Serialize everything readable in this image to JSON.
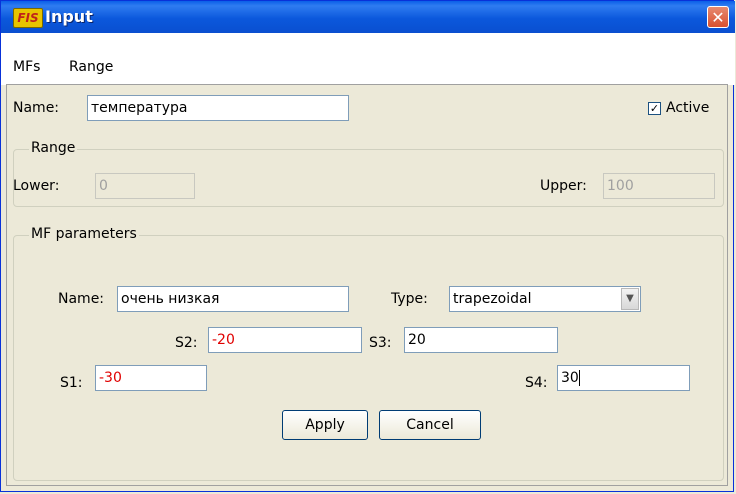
{
  "window": {
    "title": "Input",
    "app_icon": "FIS",
    "close": "✕"
  },
  "menu": {
    "items": [
      "MFs",
      "Range"
    ]
  },
  "variable": {
    "name_label": "Name:",
    "name_value": "температура",
    "active_label": "Active",
    "active_checked": "✓"
  },
  "range": {
    "title": "Range",
    "lower_label": "Lower:",
    "lower_value": "0",
    "upper_label": "Upper:",
    "upper_value": "100"
  },
  "mf": {
    "title": "MF parameters",
    "name_label": "Name:",
    "name_value": "очень низкая",
    "type_label": "Type:",
    "type_value": "trapezoidal",
    "s1_label": "S1:",
    "s1_value": "-30",
    "s2_label": "S2:",
    "s2_value": "-20",
    "s3_label": "S3:",
    "s3_value": "20",
    "s4_label": "S4:",
    "s4_value": "30"
  },
  "buttons": {
    "apply": "Apply",
    "cancel": "Cancel"
  },
  "colors": {
    "titlebar": "#0a5fe8",
    "invalid_value": "#e00000"
  }
}
